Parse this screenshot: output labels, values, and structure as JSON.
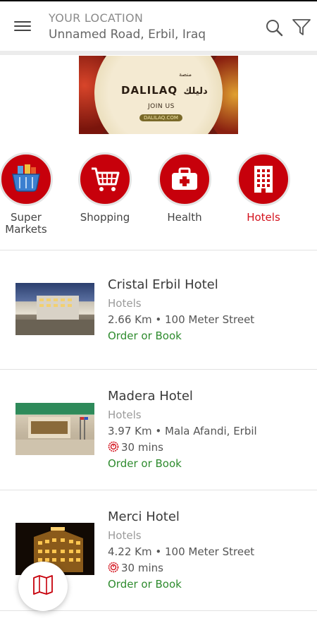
{
  "header": {
    "location_label": "YOUR LOCATION",
    "location_value": "Unnamed Road, Erbil, Iraq",
    "menu_icon": "hamburger-menu-icon",
    "search_icon": "search-icon",
    "filter_icon": "filter-funnel-icon"
  },
  "banner": {
    "arabic_top": "منصة",
    "arabic_name": "دليلك",
    "title": "DALILAQ",
    "subtitle": "JOIN US",
    "url": "DALILAQ.COM"
  },
  "categories": [
    {
      "label": "Super\nMarkets",
      "icon": "shopping-basket-icon",
      "active": false
    },
    {
      "label": "Shopping",
      "icon": "shopping-cart-icon",
      "active": false
    },
    {
      "label": "Health",
      "icon": "first-aid-kit-icon",
      "active": false
    },
    {
      "label": "Hotels",
      "icon": "hotel-building-icon",
      "active": true
    }
  ],
  "listings": [
    {
      "name": "Cristal Erbil Hotel",
      "category": "Hotels",
      "distance": "2.66 Km • 100 Meter Street",
      "time": "",
      "action": "Order or Book"
    },
    {
      "name": "Madera Hotel",
      "category": "Hotels",
      "distance": "3.97 Km • Mala Afandi, Erbil",
      "time": "30 mins",
      "action": "Order or Book"
    },
    {
      "name": "Merci Hotel",
      "category": "Hotels",
      "distance": "4.22 Km • 100 Meter Street",
      "time": "30 mins",
      "action": "Order or Book"
    }
  ],
  "colors": {
    "accent_red": "#c7000b",
    "active_label": "#d3101b",
    "order_green": "#2e8b2e"
  },
  "fab": {
    "icon": "map-icon"
  }
}
